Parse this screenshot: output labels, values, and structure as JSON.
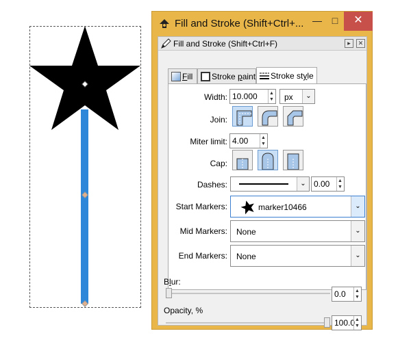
{
  "window": {
    "title": "Fill and Stroke (Shift+Ctrl+...",
    "minimize_icon": "minimize-icon",
    "maximize_icon": "maximize-icon",
    "close_icon": "close-icon"
  },
  "dock": {
    "title": "Fill and Stroke (Shift+Ctrl+F)"
  },
  "tabs": [
    {
      "label_pre": "",
      "label_ul": "F",
      "label_post": "ill"
    },
    {
      "label_pre": "Stroke ",
      "label_ul": "p",
      "label_post": "aint"
    },
    {
      "label_pre": "Stroke st",
      "label_ul": "y",
      "label_post": "le"
    }
  ],
  "stroke_style": {
    "width_label": "Width:",
    "width_value": "10.000",
    "unit": "px",
    "join_label": "Join:",
    "miter_label": "Miter limit:",
    "miter_value": "4.00",
    "cap_label": "Cap:",
    "dashes_label": "Dashes:",
    "dash_offset": "0.00",
    "start_markers_label": "Start Markers:",
    "start_marker_value": "marker10466",
    "mid_markers_label": "Mid Markers:",
    "mid_marker_value": "None",
    "end_markers_label": "End Markers:",
    "end_marker_value": "None"
  },
  "blur": {
    "label_pre": "B",
    "label_ul": "l",
    "label_post": "ur:",
    "value": "0.0",
    "level": 0.0
  },
  "opacity": {
    "label": "Opacity, %",
    "value": "100.0",
    "level": 1.0
  },
  "colors": {
    "titlebar": "#e9b64a",
    "close_button": "#c7504b",
    "stroke_blue": "#2e87d8",
    "active_toggle": "#c9dff5"
  }
}
